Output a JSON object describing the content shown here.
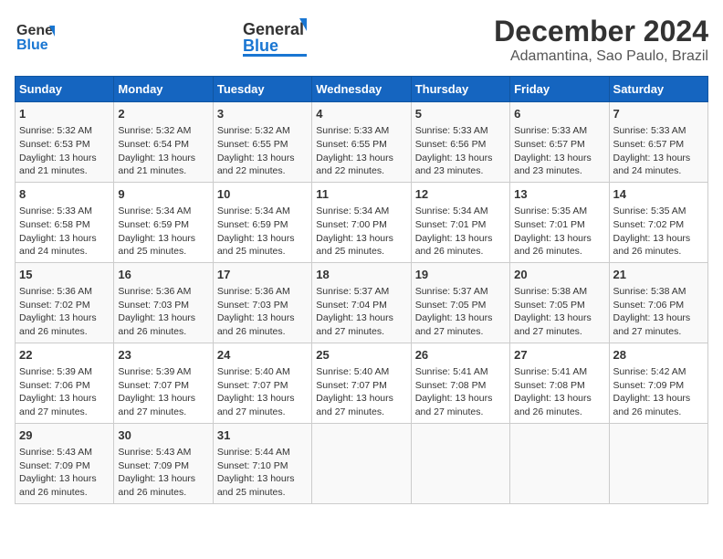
{
  "header": {
    "logo_general": "General",
    "logo_blue": "Blue",
    "title": "December 2024",
    "subtitle": "Adamantina, Sao Paulo, Brazil"
  },
  "calendar": {
    "days_of_week": [
      "Sunday",
      "Monday",
      "Tuesday",
      "Wednesday",
      "Thursday",
      "Friday",
      "Saturday"
    ],
    "weeks": [
      [
        {
          "num": "1",
          "sunrise": "Sunrise: 5:32 AM",
          "sunset": "Sunset: 6:53 PM",
          "daylight": "Daylight: 13 hours and 21 minutes."
        },
        {
          "num": "2",
          "sunrise": "Sunrise: 5:32 AM",
          "sunset": "Sunset: 6:54 PM",
          "daylight": "Daylight: 13 hours and 21 minutes."
        },
        {
          "num": "3",
          "sunrise": "Sunrise: 5:32 AM",
          "sunset": "Sunset: 6:55 PM",
          "daylight": "Daylight: 13 hours and 22 minutes."
        },
        {
          "num": "4",
          "sunrise": "Sunrise: 5:33 AM",
          "sunset": "Sunset: 6:55 PM",
          "daylight": "Daylight: 13 hours and 22 minutes."
        },
        {
          "num": "5",
          "sunrise": "Sunrise: 5:33 AM",
          "sunset": "Sunset: 6:56 PM",
          "daylight": "Daylight: 13 hours and 23 minutes."
        },
        {
          "num": "6",
          "sunrise": "Sunrise: 5:33 AM",
          "sunset": "Sunset: 6:57 PM",
          "daylight": "Daylight: 13 hours and 23 minutes."
        },
        {
          "num": "7",
          "sunrise": "Sunrise: 5:33 AM",
          "sunset": "Sunset: 6:57 PM",
          "daylight": "Daylight: 13 hours and 24 minutes."
        }
      ],
      [
        {
          "num": "8",
          "sunrise": "Sunrise: 5:33 AM",
          "sunset": "Sunset: 6:58 PM",
          "daylight": "Daylight: 13 hours and 24 minutes."
        },
        {
          "num": "9",
          "sunrise": "Sunrise: 5:34 AM",
          "sunset": "Sunset: 6:59 PM",
          "daylight": "Daylight: 13 hours and 25 minutes."
        },
        {
          "num": "10",
          "sunrise": "Sunrise: 5:34 AM",
          "sunset": "Sunset: 6:59 PM",
          "daylight": "Daylight: 13 hours and 25 minutes."
        },
        {
          "num": "11",
          "sunrise": "Sunrise: 5:34 AM",
          "sunset": "Sunset: 7:00 PM",
          "daylight": "Daylight: 13 hours and 25 minutes."
        },
        {
          "num": "12",
          "sunrise": "Sunrise: 5:34 AM",
          "sunset": "Sunset: 7:01 PM",
          "daylight": "Daylight: 13 hours and 26 minutes."
        },
        {
          "num": "13",
          "sunrise": "Sunrise: 5:35 AM",
          "sunset": "Sunset: 7:01 PM",
          "daylight": "Daylight: 13 hours and 26 minutes."
        },
        {
          "num": "14",
          "sunrise": "Sunrise: 5:35 AM",
          "sunset": "Sunset: 7:02 PM",
          "daylight": "Daylight: 13 hours and 26 minutes."
        }
      ],
      [
        {
          "num": "15",
          "sunrise": "Sunrise: 5:36 AM",
          "sunset": "Sunset: 7:02 PM",
          "daylight": "Daylight: 13 hours and 26 minutes."
        },
        {
          "num": "16",
          "sunrise": "Sunrise: 5:36 AM",
          "sunset": "Sunset: 7:03 PM",
          "daylight": "Daylight: 13 hours and 26 minutes."
        },
        {
          "num": "17",
          "sunrise": "Sunrise: 5:36 AM",
          "sunset": "Sunset: 7:03 PM",
          "daylight": "Daylight: 13 hours and 26 minutes."
        },
        {
          "num": "18",
          "sunrise": "Sunrise: 5:37 AM",
          "sunset": "Sunset: 7:04 PM",
          "daylight": "Daylight: 13 hours and 27 minutes."
        },
        {
          "num": "19",
          "sunrise": "Sunrise: 5:37 AM",
          "sunset": "Sunset: 7:05 PM",
          "daylight": "Daylight: 13 hours and 27 minutes."
        },
        {
          "num": "20",
          "sunrise": "Sunrise: 5:38 AM",
          "sunset": "Sunset: 7:05 PM",
          "daylight": "Daylight: 13 hours and 27 minutes."
        },
        {
          "num": "21",
          "sunrise": "Sunrise: 5:38 AM",
          "sunset": "Sunset: 7:06 PM",
          "daylight": "Daylight: 13 hours and 27 minutes."
        }
      ],
      [
        {
          "num": "22",
          "sunrise": "Sunrise: 5:39 AM",
          "sunset": "Sunset: 7:06 PM",
          "daylight": "Daylight: 13 hours and 27 minutes."
        },
        {
          "num": "23",
          "sunrise": "Sunrise: 5:39 AM",
          "sunset": "Sunset: 7:07 PM",
          "daylight": "Daylight: 13 hours and 27 minutes."
        },
        {
          "num": "24",
          "sunrise": "Sunrise: 5:40 AM",
          "sunset": "Sunset: 7:07 PM",
          "daylight": "Daylight: 13 hours and 27 minutes."
        },
        {
          "num": "25",
          "sunrise": "Sunrise: 5:40 AM",
          "sunset": "Sunset: 7:07 PM",
          "daylight": "Daylight: 13 hours and 27 minutes."
        },
        {
          "num": "26",
          "sunrise": "Sunrise: 5:41 AM",
          "sunset": "Sunset: 7:08 PM",
          "daylight": "Daylight: 13 hours and 27 minutes."
        },
        {
          "num": "27",
          "sunrise": "Sunrise: 5:41 AM",
          "sunset": "Sunset: 7:08 PM",
          "daylight": "Daylight: 13 hours and 26 minutes."
        },
        {
          "num": "28",
          "sunrise": "Sunrise: 5:42 AM",
          "sunset": "Sunset: 7:09 PM",
          "daylight": "Daylight: 13 hours and 26 minutes."
        }
      ],
      [
        {
          "num": "29",
          "sunrise": "Sunrise: 5:43 AM",
          "sunset": "Sunset: 7:09 PM",
          "daylight": "Daylight: 13 hours and 26 minutes."
        },
        {
          "num": "30",
          "sunrise": "Sunrise: 5:43 AM",
          "sunset": "Sunset: 7:09 PM",
          "daylight": "Daylight: 13 hours and 26 minutes."
        },
        {
          "num": "31",
          "sunrise": "Sunrise: 5:44 AM",
          "sunset": "Sunset: 7:10 PM",
          "daylight": "Daylight: 13 hours and 25 minutes."
        },
        {
          "num": "",
          "sunrise": "",
          "sunset": "",
          "daylight": ""
        },
        {
          "num": "",
          "sunrise": "",
          "sunset": "",
          "daylight": ""
        },
        {
          "num": "",
          "sunrise": "",
          "sunset": "",
          "daylight": ""
        },
        {
          "num": "",
          "sunrise": "",
          "sunset": "",
          "daylight": ""
        }
      ]
    ]
  }
}
